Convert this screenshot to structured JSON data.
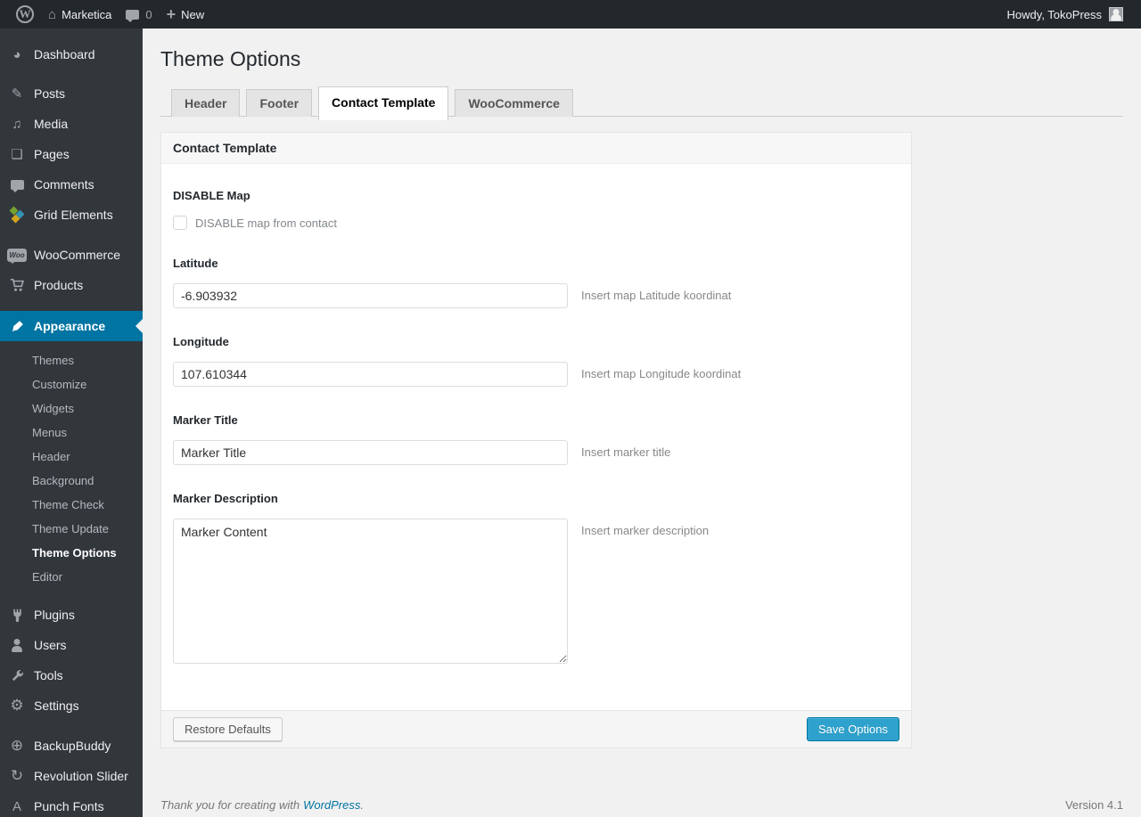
{
  "admin_bar": {
    "site_name": "Marketica",
    "comment_count": "0",
    "new_label": "New",
    "howdy_text": "Howdy, TokoPress"
  },
  "icons": {
    "wordpress_w": "W",
    "home": "⌂",
    "plus": "+",
    "dashboard": "◕",
    "posts": "✎",
    "media": "♫",
    "pages": "❏",
    "settings": "⚙",
    "backupbuddy": "⊕",
    "revolution_slider": "↻",
    "punch_fonts": "A",
    "woo_badge": "Woo"
  },
  "sidebar": {
    "items": [
      {
        "label": "Dashboard"
      },
      {
        "label": "Posts"
      },
      {
        "label": "Media"
      },
      {
        "label": "Pages"
      },
      {
        "label": "Comments"
      },
      {
        "label": "Grid Elements"
      },
      {
        "label": "WooCommerce"
      },
      {
        "label": "Products"
      },
      {
        "label": "Appearance",
        "active": true
      },
      {
        "label": "Plugins"
      },
      {
        "label": "Users"
      },
      {
        "label": "Tools"
      },
      {
        "label": "Settings"
      },
      {
        "label": "BackupBuddy"
      },
      {
        "label": "Revolution Slider"
      },
      {
        "label": "Punch Fonts"
      }
    ],
    "appearance_submenu": [
      "Themes",
      "Customize",
      "Widgets",
      "Menus",
      "Header",
      "Background",
      "Theme Check",
      "Theme Update",
      "Theme Options",
      "Editor"
    ],
    "current_submenu_item": "Theme Options"
  },
  "page": {
    "title": "Theme Options",
    "tabs": [
      {
        "label": "Header"
      },
      {
        "label": "Footer"
      },
      {
        "label": "Contact Template"
      },
      {
        "label": "WooCommerce"
      }
    ],
    "active_tab": "Contact Template",
    "panel": {
      "heading": "Contact Template",
      "disable_map": {
        "label": "DISABLE Map",
        "checkbox_label": "DISABLE map from contact",
        "checked": false
      },
      "latitude": {
        "label": "Latitude",
        "value": "-6.903932",
        "help": "Insert map Latitude koordinat"
      },
      "longitude": {
        "label": "Longitude",
        "value": "107.610344",
        "help": "Insert map Longitude koordinat"
      },
      "marker_title": {
        "label": "Marker Title",
        "value": "Marker Title",
        "help": "Insert marker title"
      },
      "marker_description": {
        "label": "Marker Description",
        "value": "Marker Content",
        "help": "Insert marker description"
      },
      "restore_button_label": "Restore Defaults",
      "save_button_label": "Save Options"
    },
    "footer": {
      "thanks_text": "Thank you for creating with",
      "link_text": "WordPress",
      "period": ".",
      "version_text": "Version 4.1"
    }
  },
  "colors": {
    "accent_blue": "#0074a2",
    "button_primary": "#2ea2cc",
    "admin_bar_bg": "#23282d",
    "sidebar_bg": "#32373c",
    "page_bg": "#f1f1f1"
  }
}
